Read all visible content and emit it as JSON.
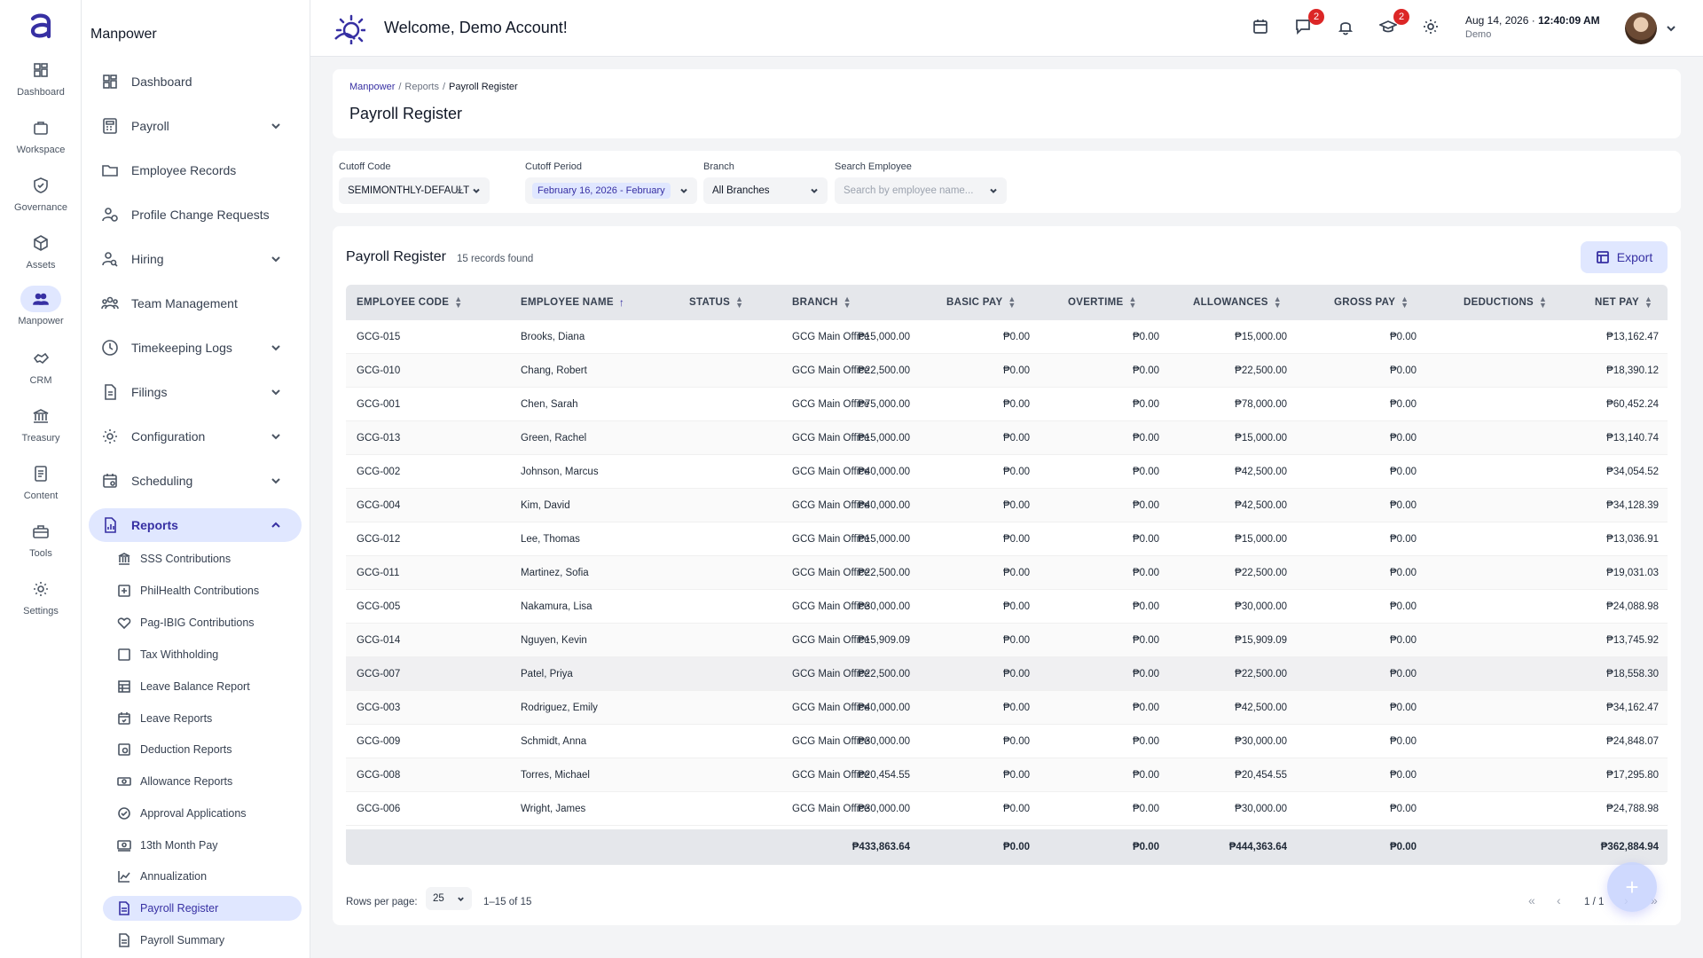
{
  "rail": [
    {
      "label": "Dashboard",
      "icon": "dashboard-icon"
    },
    {
      "label": "Workspace",
      "icon": "briefcase-icon"
    },
    {
      "label": "Governance",
      "icon": "shield-icon"
    },
    {
      "label": "Assets",
      "icon": "box-icon"
    },
    {
      "label": "Manpower",
      "icon": "people-icon"
    },
    {
      "label": "CRM",
      "icon": "handshake-icon"
    },
    {
      "label": "Treasury",
      "icon": "bank-icon"
    },
    {
      "label": "Content",
      "icon": "document-icon"
    },
    {
      "label": "Tools",
      "icon": "toolbox-icon"
    },
    {
      "label": "Settings",
      "icon": "gear-icon"
    }
  ],
  "sidebar": {
    "title": "Manpower",
    "items": [
      {
        "label": "Dashboard",
        "icon": "dashboard-icon"
      },
      {
        "label": "Payroll",
        "icon": "calculator-icon"
      },
      {
        "label": "Employee Records",
        "icon": "folder-icon"
      },
      {
        "label": "Profile Change Requests",
        "icon": "person-change-icon"
      },
      {
        "label": "Hiring",
        "icon": "person-search-icon"
      },
      {
        "label": "Team Management",
        "icon": "team-icon"
      },
      {
        "label": "Timekeeping Logs",
        "icon": "clock-icon"
      },
      {
        "label": "Filings",
        "icon": "file-icon"
      },
      {
        "label": "Configuration",
        "icon": "gear-icon"
      },
      {
        "label": "Scheduling",
        "icon": "calendar-icon"
      },
      {
        "label": "Reports",
        "icon": "report-icon"
      }
    ],
    "report_items": [
      {
        "label": "SSS Contributions",
        "icon": "bank-icon"
      },
      {
        "label": "PhilHealth Contributions",
        "icon": "plus-square-icon"
      },
      {
        "label": "Pag-IBIG Contributions",
        "icon": "heart-icon"
      },
      {
        "label": "Tax Withholding",
        "icon": "square-icon"
      },
      {
        "label": "Leave Balance Report",
        "icon": "table-icon"
      },
      {
        "label": "Leave Reports",
        "icon": "calendar-check-icon"
      },
      {
        "label": "Deduction Reports",
        "icon": "deduction-icon"
      },
      {
        "label": "Allowance Reports",
        "icon": "money-icon"
      },
      {
        "label": "Approval Applications",
        "icon": "check-circle-icon"
      },
      {
        "label": "13th Month Pay",
        "icon": "cash-icon"
      },
      {
        "label": "Annualization",
        "icon": "chart-line-icon"
      },
      {
        "label": "Payroll Register",
        "icon": "doc-icon"
      },
      {
        "label": "Payroll Summary",
        "icon": "doc-icon"
      }
    ]
  },
  "header": {
    "welcome": "Welcome, Demo Account!",
    "messages_badge": "2",
    "training_badge": "2",
    "date": "Aug 14, 2026",
    "dot": "·",
    "time": "12:40:09 AM",
    "user": "Demo"
  },
  "breadcrumb": [
    "Manpower",
    "Reports",
    "Payroll Register"
  ],
  "breadcrumb_sep": "/",
  "page_title": "Payroll Register",
  "filters": {
    "cutoff_code_label": "Cutoff Code",
    "cutoff_code_value": "SEMIMONTHLY-DEFAULT",
    "clear_glyph": "×",
    "cutoff_period_label": "Cutoff Period",
    "cutoff_period_value": "February 16, 2026 - February",
    "branch_label": "Branch",
    "branch_value": "All Branches",
    "search_label": "Search Employee",
    "search_placeholder": "Search by employee name..."
  },
  "table": {
    "title": "Payroll Register",
    "count": "15 records found",
    "export_label": "Export",
    "columns": [
      "EMPLOYEE CODE",
      "EMPLOYEE NAME",
      "STATUS",
      "BRANCH",
      "BASIC PAY",
      "OVERTIME",
      "ALLOWANCES",
      "GROSS PAY",
      "DEDUCTIONS",
      "NET PAY"
    ],
    "rows": [
      [
        "GCG-015",
        "Brooks, Diana",
        "",
        "GCG Main Office",
        "₱15,000.00",
        "₱0.00",
        "₱0.00",
        "₱15,000.00",
        "₱0.00",
        "₱13,162.47"
      ],
      [
        "GCG-010",
        "Chang, Robert",
        "",
        "GCG Main Office",
        "₱22,500.00",
        "₱0.00",
        "₱0.00",
        "₱22,500.00",
        "₱0.00",
        "₱18,390.12"
      ],
      [
        "GCG-001",
        "Chen, Sarah",
        "",
        "GCG Main Office",
        "₱75,000.00",
        "₱0.00",
        "₱0.00",
        "₱78,000.00",
        "₱0.00",
        "₱60,452.24"
      ],
      [
        "GCG-013",
        "Green, Rachel",
        "",
        "GCG Main Office",
        "₱15,000.00",
        "₱0.00",
        "₱0.00",
        "₱15,000.00",
        "₱0.00",
        "₱13,140.74"
      ],
      [
        "GCG-002",
        "Johnson, Marcus",
        "",
        "GCG Main Office",
        "₱40,000.00",
        "₱0.00",
        "₱0.00",
        "₱42,500.00",
        "₱0.00",
        "₱34,054.52"
      ],
      [
        "GCG-004",
        "Kim, David",
        "",
        "GCG Main Office",
        "₱40,000.00",
        "₱0.00",
        "₱0.00",
        "₱42,500.00",
        "₱0.00",
        "₱34,128.39"
      ],
      [
        "GCG-012",
        "Lee, Thomas",
        "",
        "GCG Main Office",
        "₱15,000.00",
        "₱0.00",
        "₱0.00",
        "₱15,000.00",
        "₱0.00",
        "₱13,036.91"
      ],
      [
        "GCG-011",
        "Martinez, Sofia",
        "",
        "GCG Main Office",
        "₱22,500.00",
        "₱0.00",
        "₱0.00",
        "₱22,500.00",
        "₱0.00",
        "₱19,031.03"
      ],
      [
        "GCG-005",
        "Nakamura, Lisa",
        "",
        "GCG Main Office",
        "₱30,000.00",
        "₱0.00",
        "₱0.00",
        "₱30,000.00",
        "₱0.00",
        "₱24,088.98"
      ],
      [
        "GCG-014",
        "Nguyen, Kevin",
        "",
        "GCG Main Office",
        "₱15,909.09",
        "₱0.00",
        "₱0.00",
        "₱15,909.09",
        "₱0.00",
        "₱13,745.92"
      ],
      [
        "GCG-007",
        "Patel, Priya",
        "",
        "GCG Main Office",
        "₱22,500.00",
        "₱0.00",
        "₱0.00",
        "₱22,500.00",
        "₱0.00",
        "₱18,558.30"
      ],
      [
        "GCG-003",
        "Rodriguez, Emily",
        "",
        "GCG Main Office",
        "₱40,000.00",
        "₱0.00",
        "₱0.00",
        "₱42,500.00",
        "₱0.00",
        "₱34,162.47"
      ],
      [
        "GCG-009",
        "Schmidt, Anna",
        "",
        "GCG Main Office",
        "₱30,000.00",
        "₱0.00",
        "₱0.00",
        "₱30,000.00",
        "₱0.00",
        "₱24,848.07"
      ],
      [
        "GCG-008",
        "Torres, Michael",
        "",
        "GCG Main Office",
        "₱20,454.55",
        "₱0.00",
        "₱0.00",
        "₱20,454.55",
        "₱0.00",
        "₱17,295.80"
      ],
      [
        "GCG-006",
        "Wright, James",
        "",
        "GCG Main Office",
        "₱30,000.00",
        "₱0.00",
        "₱0.00",
        "₱30,000.00",
        "₱0.00",
        "₱24,788.98"
      ]
    ],
    "totals": [
      "₱433,863.64",
      "₱0.00",
      "₱0.00",
      "₱444,363.64",
      "₱0.00",
      "₱362,884.94"
    ]
  },
  "pagination": {
    "rows_per_page_label": "Rows per page:",
    "rows_per_page": "25",
    "range": "1–15 of 15",
    "page_info": "1 / 1",
    "first": "«",
    "prev": "‹",
    "next": "›",
    "last": "»"
  },
  "fab": "+",
  "colors": {
    "accent": "#3730a3",
    "accent_light": "#e0e7ff",
    "badge": "#dc2626"
  }
}
